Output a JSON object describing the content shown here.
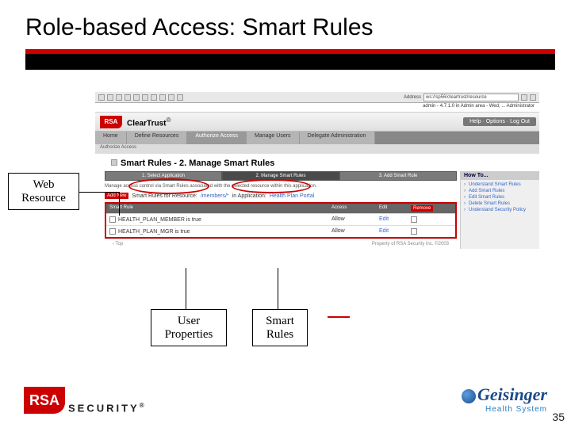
{
  "slide": {
    "title": "Role-based Access: Smart Rules",
    "page_number": "35"
  },
  "callouts": {
    "web": "Web Resource",
    "user": "User Properties",
    "smart": "Smart Rules"
  },
  "toolbar": {
    "address_label": "Address",
    "address_value": "ws://sp56/cleartrust/resource",
    "admin_line": "admin - 4.7.1.0 in Admin area - Wed, ... Administrator"
  },
  "brand": {
    "rsa": "RSA",
    "product": "ClearTrust",
    "reg": "®",
    "links": "Help · Options · Log Out"
  },
  "tabs": [
    "Home",
    "Define Resources",
    "Authorize Access",
    "Manage Users",
    "Delegate Administration"
  ],
  "subrow": "Authorize Access",
  "page": {
    "heading": "Smart Rules - 2. Manage Smart Rules"
  },
  "steps": [
    "1. Select Application",
    "2. Manage Smart Rules",
    "3. Add Smart Rule"
  ],
  "manage_line": "Manage access control via Smart Rules associated with the selected resource within this application.",
  "addrow": {
    "add": "Add New",
    "label": "Smart Rules for Resource:",
    "resource": "/members/*",
    "in_app": "in Application:",
    "app": "Health Plan Portal"
  },
  "rules_header": {
    "c1": "Smart Rule",
    "c2": "Access",
    "c3": "Edit",
    "c4": "Remove"
  },
  "rules": [
    {
      "name": "HEALTH_PLAN_MEMBER is true",
      "access": "Allow",
      "edit": "Edit"
    },
    {
      "name": "HEALTH_PLAN_MGR is true",
      "access": "Allow",
      "edit": "Edit"
    }
  ],
  "bottom": {
    "top": "‹ Top",
    "prop": "Property of RSA Security Inc. ©2003"
  },
  "howto": {
    "title": "How To...",
    "items": [
      "Understand Smart Rules",
      "Add Smart Rules",
      "Edit Smart Rules",
      "Delete Smart Rules",
      "Understand Security Policy"
    ]
  },
  "footer": {
    "rsa": "RSA",
    "security": "SECURITY",
    "geisinger": "Geisinger",
    "hs": "Health System"
  }
}
